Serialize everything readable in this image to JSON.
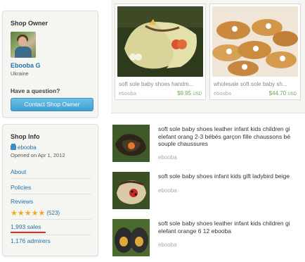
{
  "owner": {
    "title": "Shop Owner",
    "name": "Ebooba G",
    "location": "Ukraine",
    "question": "Have a question?",
    "contact_label": "Contact Shop Owner"
  },
  "info": {
    "title": "Shop Info",
    "shop_name": "ebooba",
    "opened": "Opened on Apr 1, 2012",
    "about": "About",
    "policies": "Policies",
    "reviews": "Reviews",
    "rating": 5,
    "review_count": "(523)",
    "sales": "1,993 sales",
    "admirers": "1,176 admirers"
  },
  "featured": [
    {
      "title": "soft sole baby shoes handm...",
      "shop": "ebooba",
      "price": "$9.95",
      "currency": "USD"
    },
    {
      "title": "wholesale soft sole baby sh...",
      "shop": "ebooba",
      "price": "$44.70",
      "currency": "USD"
    }
  ],
  "listings": [
    {
      "title_lines": [
        "soft sole baby shoes leather infant kids children gi",
        "elefant orang 2-3 bébés garçon fille chaussons bé",
        "souple chaussures"
      ],
      "shop": "ebooba"
    },
    {
      "title_lines": [
        "soft sole baby shoes infant kids gift ladybird beige"
      ],
      "shop": "ebooba"
    },
    {
      "title_lines": [
        "soft sole baby shoes leather infant kids children gi",
        "elefant orange 6 12 ebooba"
      ],
      "shop": "ebooba"
    }
  ],
  "icons": {
    "star": "star-icon",
    "shop": "shop-icon"
  },
  "colors": {
    "link": "#2173a8",
    "button": "#3f9fd2",
    "star": "#f2a920",
    "price": "#6aa84f",
    "underline": "#e0282d"
  }
}
